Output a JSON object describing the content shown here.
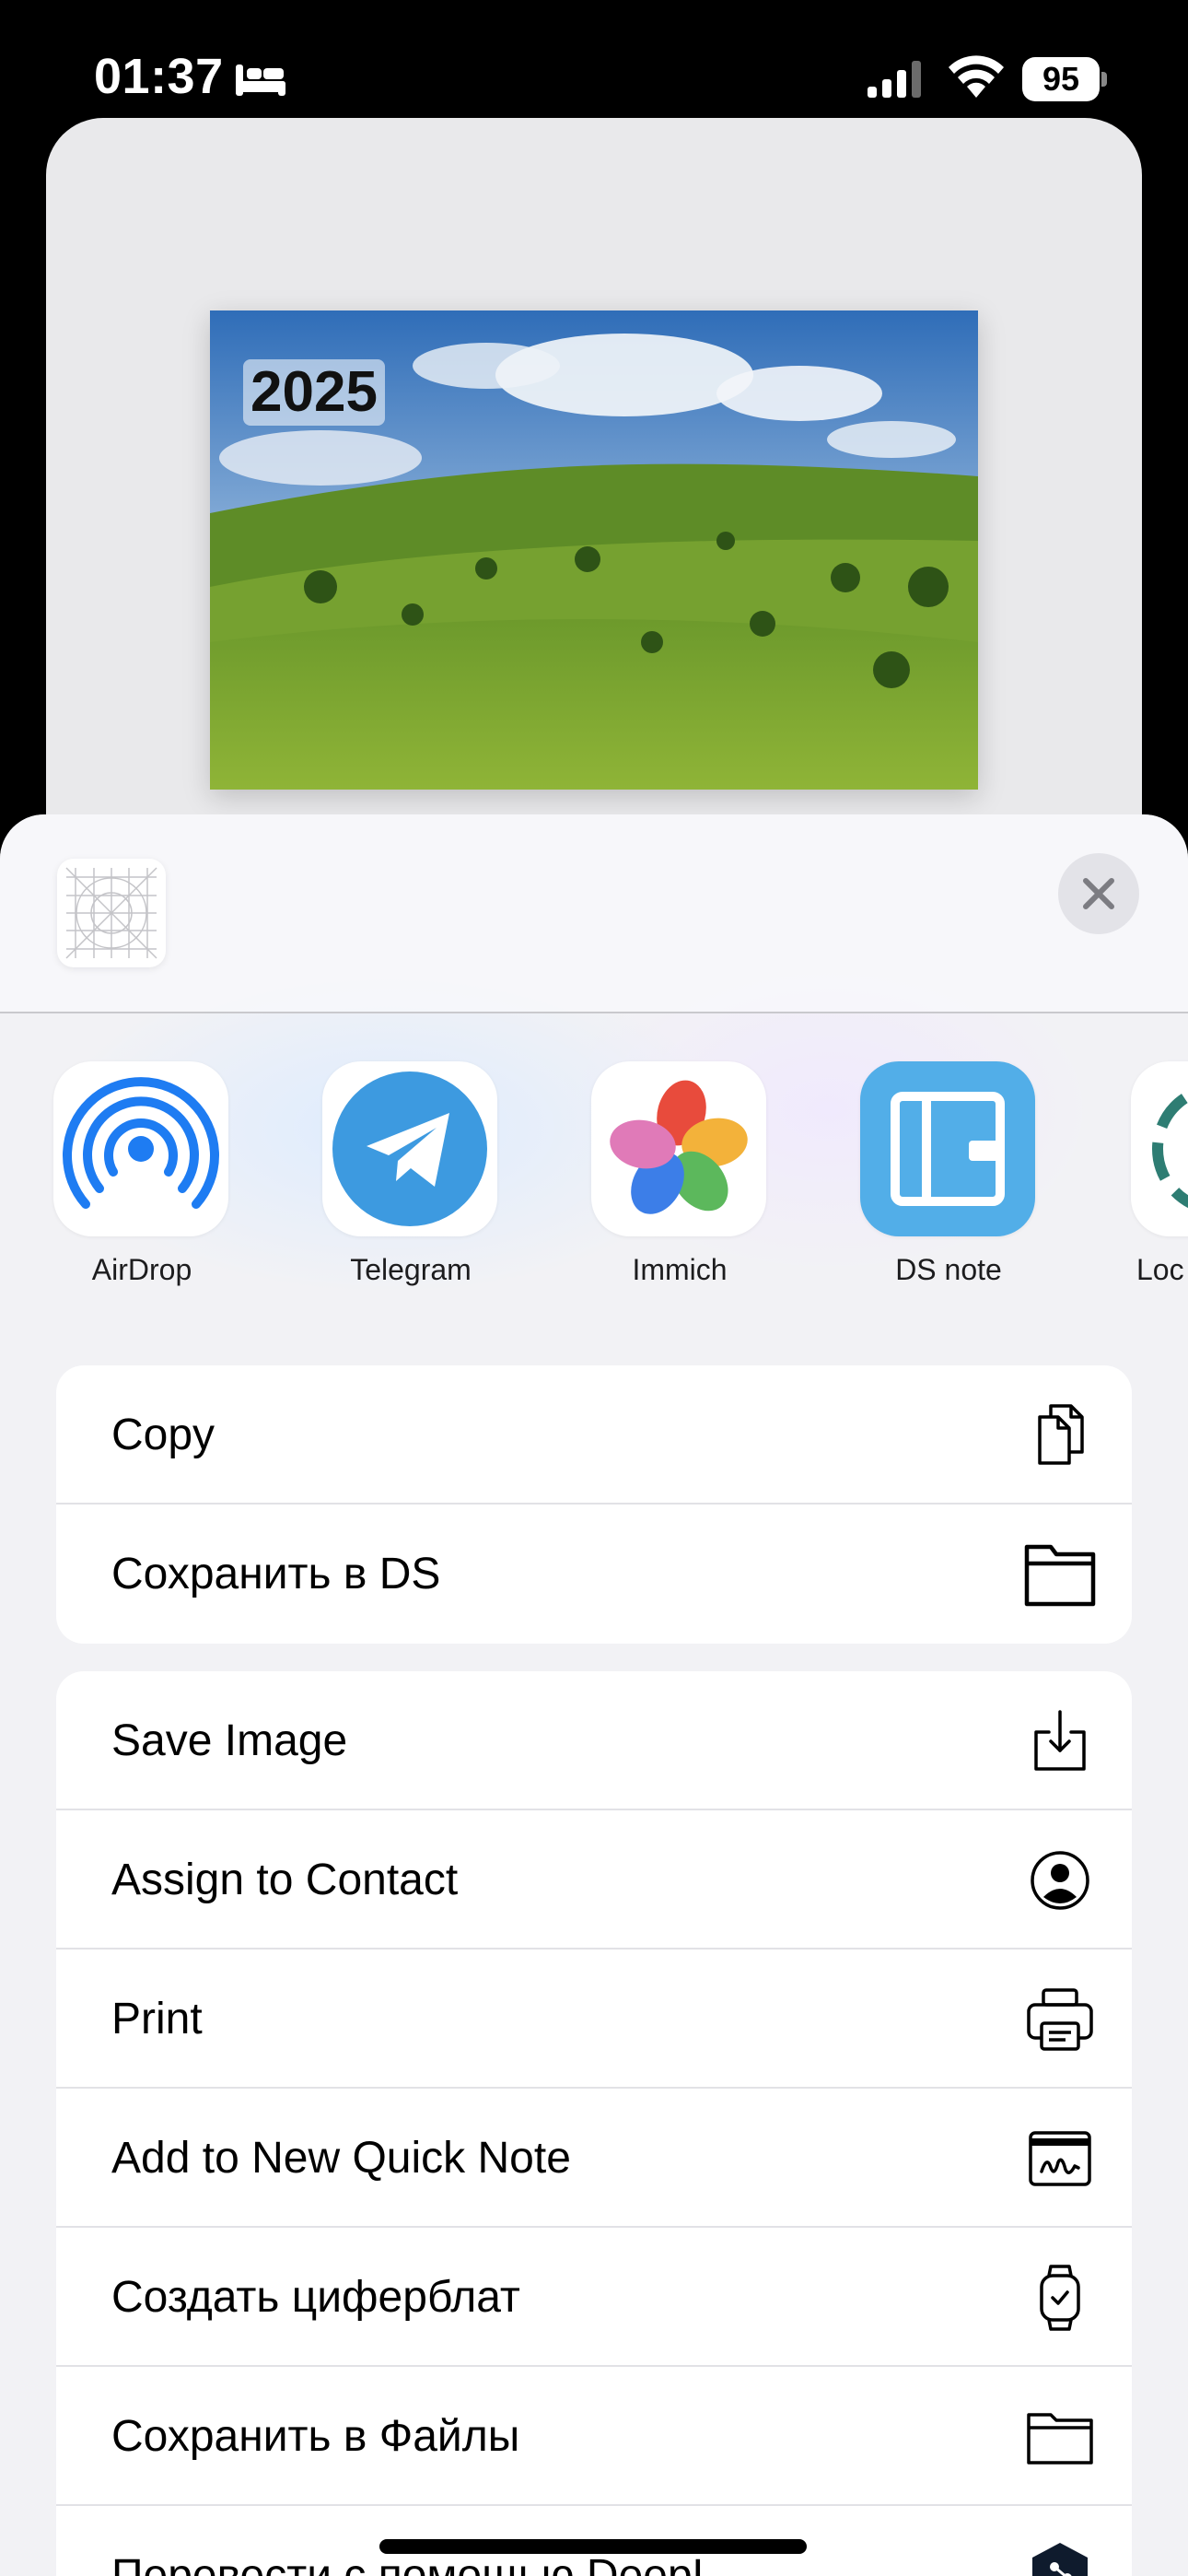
{
  "status_bar": {
    "time": "01:37",
    "battery": "95",
    "icons": [
      "bed-icon",
      "cellular-signal-icon",
      "wifi-icon",
      "battery-icon"
    ]
  },
  "preview": {
    "year_overlay": "2025"
  },
  "share_sheet": {
    "close_icon": "close-icon",
    "apps": [
      {
        "label": "AirDrop",
        "icon": "airdrop-icon",
        "color": "#1E7CF2"
      },
      {
        "label": "Telegram",
        "icon": "telegram-icon",
        "color": "#3D9AE0"
      },
      {
        "label": "Immich",
        "icon": "immich-icon",
        "color": "#FFFFFF"
      },
      {
        "label": "DS note",
        "icon": "ds-note-icon",
        "color": "#52AEE8"
      },
      {
        "label": "Loc",
        "icon": "location-app-icon",
        "color": "#2E7D73"
      }
    ],
    "group1": [
      {
        "label": "Copy",
        "icon": "copy-icon"
      },
      {
        "label": "Сохранить в DS",
        "icon": "folder-icon"
      }
    ],
    "group2": [
      {
        "label": "Save Image",
        "icon": "save-image-icon"
      },
      {
        "label": "Assign to Contact",
        "icon": "contact-icon"
      },
      {
        "label": "Print",
        "icon": "printer-icon"
      },
      {
        "label": "Add to New Quick Note",
        "icon": "quick-note-icon"
      },
      {
        "label": "Создать циферблат",
        "icon": "watch-icon"
      },
      {
        "label": "Сохранить в Файлы",
        "icon": "files-folder-icon"
      },
      {
        "label": "Перевести с помощью DeepL",
        "icon": "deepl-icon"
      }
    ]
  }
}
